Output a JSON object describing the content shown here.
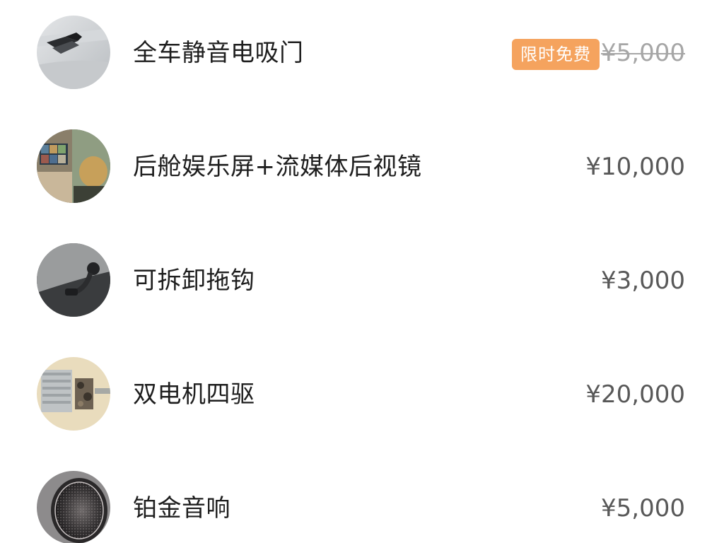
{
  "items": [
    {
      "icon": "electric-suction-door-thumb",
      "name": "全车静音电吸门",
      "badge": "限时免费",
      "price": "¥5,000",
      "price_struck": true
    },
    {
      "icon": "rear-entertainment-screen-thumb",
      "name": "后舱娱乐屏+流媒体后视镜",
      "price": "¥10,000"
    },
    {
      "icon": "tow-hook-thumb",
      "name": "可拆卸拖钩",
      "price": "¥3,000"
    },
    {
      "icon": "dual-motor-awd-thumb",
      "name": "双电机四驱",
      "price": "¥20,000"
    },
    {
      "icon": "speaker-thumb",
      "name": "铂金音响",
      "price": "¥5,000"
    }
  ],
  "colors": {
    "badge_bg": "#f5a35e",
    "price_text": "#585858",
    "struck_price_text": "#a6a6a6"
  }
}
